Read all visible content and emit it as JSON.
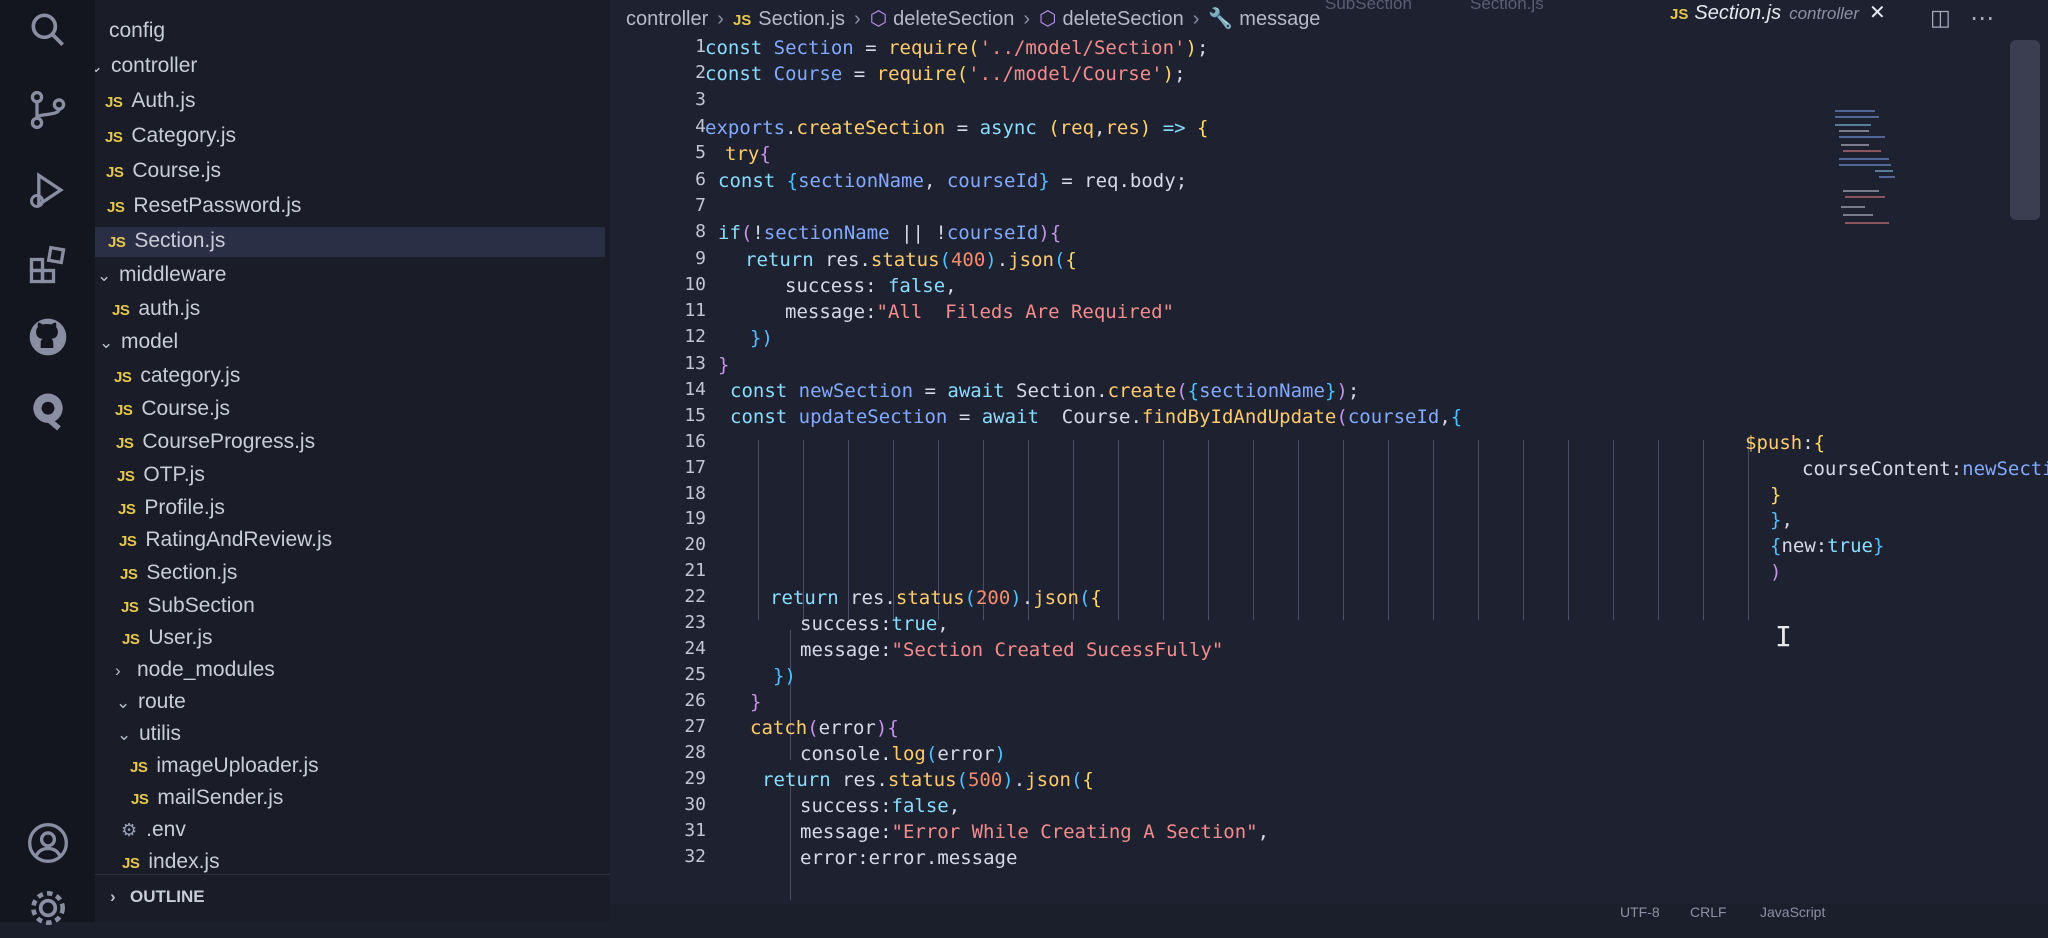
{
  "activity_bar": {
    "icons": [
      "search-icon",
      "source-control-icon",
      "run-debug-icon",
      "extensions-icon",
      "github-icon",
      "remote-icon",
      "account-icon",
      "settings-gear-icon"
    ]
  },
  "sidebar": {
    "items": [
      {
        "label": "config",
        "type": "folder",
        "expanded": false
      },
      {
        "label": "controller",
        "type": "folder",
        "expanded": true
      },
      {
        "label": "Auth.js",
        "type": "js"
      },
      {
        "label": "Category.js",
        "type": "js"
      },
      {
        "label": "Course.js",
        "type": "js"
      },
      {
        "label": "ResetPassword.js",
        "type": "js"
      },
      {
        "label": "Section.js",
        "type": "js",
        "selected": true
      },
      {
        "label": "middleware",
        "type": "folder",
        "expanded": true
      },
      {
        "label": "auth.js",
        "type": "js"
      },
      {
        "label": "model",
        "type": "folder",
        "expanded": true
      },
      {
        "label": "category.js",
        "type": "js"
      },
      {
        "label": "Course.js",
        "type": "js"
      },
      {
        "label": "CourseProgress.js",
        "type": "js"
      },
      {
        "label": "OTP.js",
        "type": "js"
      },
      {
        "label": "Profile.js",
        "type": "js"
      },
      {
        "label": "RatingAndReview.js",
        "type": "js"
      },
      {
        "label": "Section.js",
        "type": "js"
      },
      {
        "label": "SubSection",
        "type": "js"
      },
      {
        "label": "User.js",
        "type": "js"
      },
      {
        "label": "node_modules",
        "type": "folder",
        "expanded": false
      },
      {
        "label": "route",
        "type": "folder",
        "expanded": true
      },
      {
        "label": "utilis",
        "type": "folder",
        "expanded": true
      },
      {
        "label": "imageUploader.js",
        "type": "js"
      },
      {
        "label": "mailSender.js",
        "type": "js"
      },
      {
        "label": ".env",
        "type": "env"
      },
      {
        "label": "index.js",
        "type": "js"
      }
    ],
    "outline_label": "OUTLINE"
  },
  "breadcrumbs": {
    "folder": "controller",
    "file": "Section.js",
    "symbol1": "deleteSection",
    "symbol2": "deleteSection",
    "symbol3": "message"
  },
  "tabs": {
    "ghost1": "SubSection",
    "ghost2": "Section.js",
    "active_file": "Section.js",
    "active_dir": "controller",
    "close_glyph": "✕"
  },
  "editor": {
    "line_numbers": [
      "1",
      "2",
      "3",
      "4",
      "5",
      "6",
      "7",
      "8",
      "9",
      "10",
      "11",
      "12",
      "13",
      "14",
      "15",
      "16",
      "17",
      "18",
      "19",
      "20",
      "21",
      "22",
      "23",
      "24",
      "25",
      "26",
      "27",
      "28",
      "29",
      "30",
      "31",
      "32"
    ]
  },
  "statusbar": {
    "encoding": "UTF-8",
    "eol": "CRLF",
    "language": "JavaScript"
  }
}
